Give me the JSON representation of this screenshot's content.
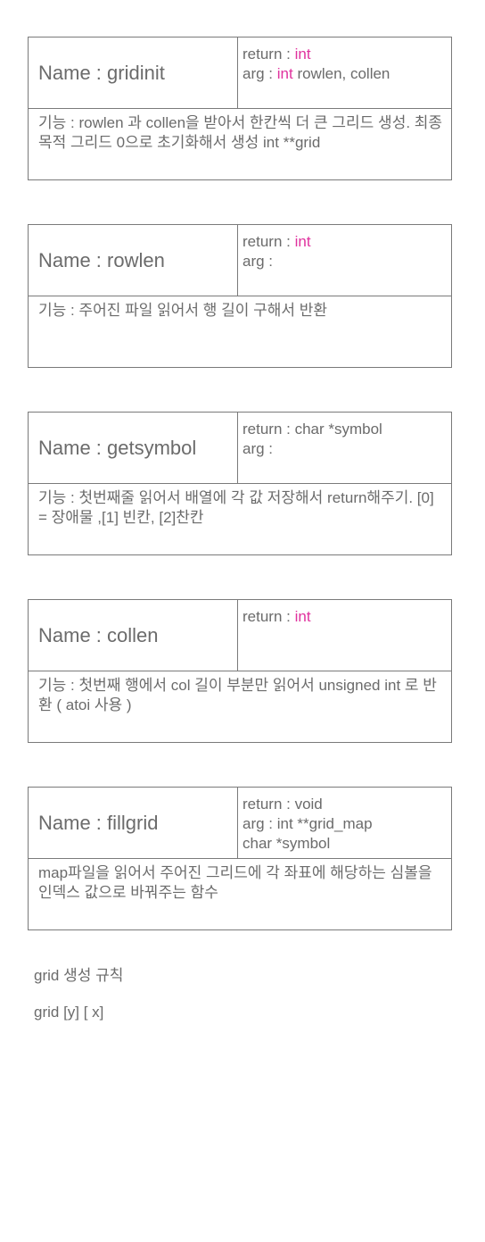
{
  "cards": [
    {
      "name": "Name : gridinit",
      "return_prefix": "return : ",
      "return_type": "int",
      "arg_prefix": "arg : ",
      "arg_type": "int",
      "arg_rest": " rowlen, collen",
      "desc": "기능 : rowlen 과 collen을 받아서 한칸씩 더 큰 그리드 생성. 최종 목적 그리드 0으로 초기화해서 생성 int **grid"
    },
    {
      "name": "Name : rowlen",
      "return_prefix": "return : ",
      "return_type": "int",
      "arg": "arg :",
      "desc": "기능 : 주어진 파일 읽어서 행 길이 구해서 반환"
    },
    {
      "name": "Name : getsymbol",
      "return": "return : char *symbol",
      "arg": "arg :",
      "desc": "기능 : 첫번째줄 읽어서 배열에 각 값 저장해서 return해주기. [0] = 장애물 ,[1] 빈칸, [2]찬칸"
    },
    {
      "name": "Name : collen",
      "return_prefix": "return : ",
      "return_type": "int",
      "desc": "기능 : 첫번째 행에서 col 길이 부분만 읽어서 unsigned int 로 반환 ( atoi 사용 )"
    },
    {
      "name": "Name : fillgrid",
      "return": "return : void",
      "arg": "arg : int **grid_map",
      "arg2": "char *symbol",
      "desc": "map파일을 읽어서 주어진 그리드에 각 좌표에 해당하는 심볼을 인덱스 값으로 바꿔주는 함수"
    }
  ],
  "notes": {
    "rule_title": "grid 생성 규칙",
    "grid_index": "grid [y] [ x]"
  },
  "colors": {
    "text": "#6b6b6b",
    "border": "#7a7a7a",
    "keyword": "#e0329e"
  }
}
